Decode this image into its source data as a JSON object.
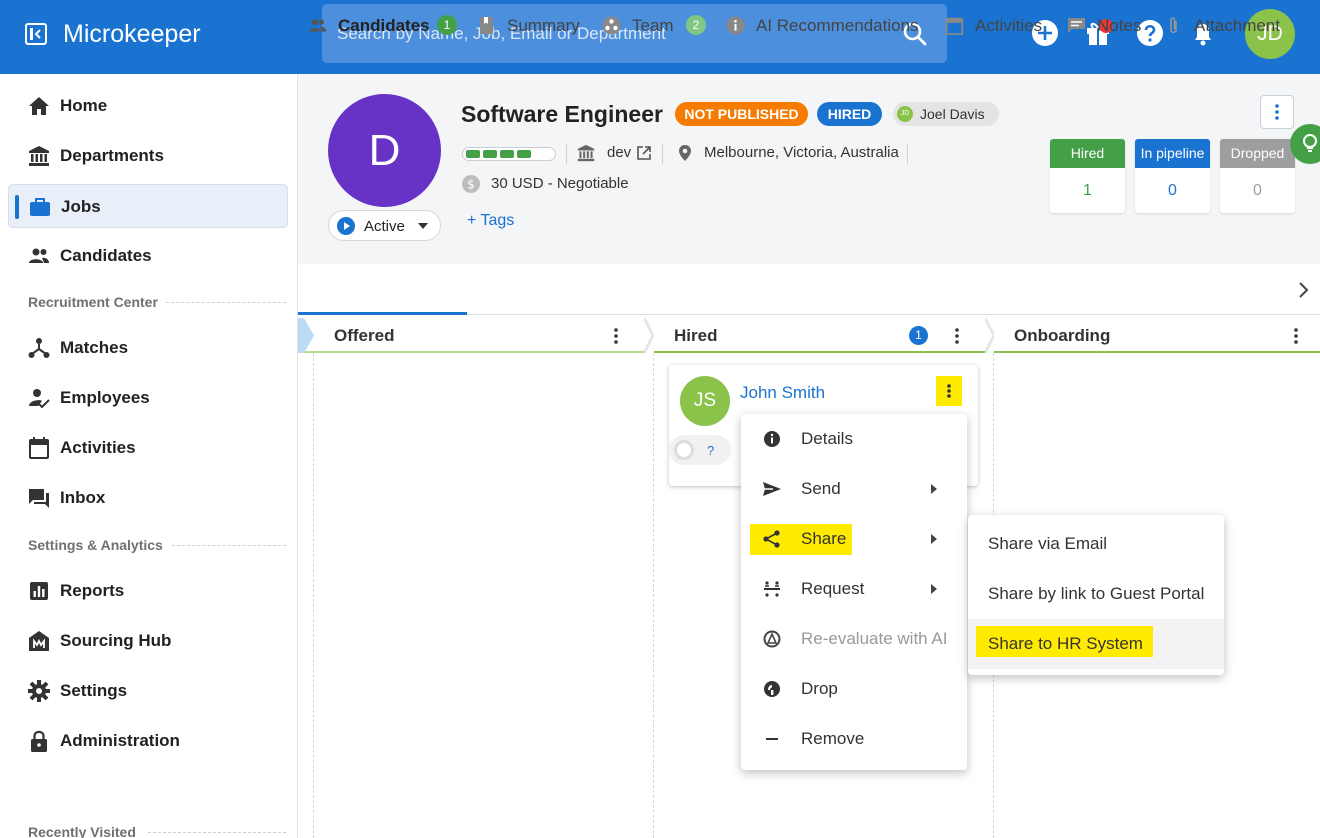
{
  "app": {
    "title": "Microkeeper",
    "search_placeholder": "Search by Name, Job, Email or Department",
    "user_initials": "JD",
    "colors": {
      "primary": "#1a73d1",
      "highlight": "#ffeb00",
      "success": "#43a047"
    }
  },
  "sidebar": {
    "items": [
      {
        "label": "Home",
        "icon": "home-icon"
      },
      {
        "label": "Departments",
        "icon": "bank-icon"
      },
      {
        "label": "Jobs",
        "icon": "briefcase-icon",
        "active": true
      },
      {
        "label": "Candidates",
        "icon": "people-icon"
      },
      {
        "label": "Matches",
        "icon": "network-icon"
      },
      {
        "label": "Employees",
        "icon": "person-check-icon"
      },
      {
        "label": "Activities",
        "icon": "calendar-icon"
      },
      {
        "label": "Inbox",
        "icon": "chat-icon"
      },
      {
        "label": "Reports",
        "icon": "bar-chart-icon"
      },
      {
        "label": "Sourcing Hub",
        "icon": "building-icon"
      },
      {
        "label": "Settings",
        "icon": "gear-icon"
      },
      {
        "label": "Administration",
        "icon": "lock-icon"
      }
    ],
    "sections": {
      "recruitment": "Recruitment Center",
      "settings": "Settings & Analytics",
      "recent": "Recently Visited"
    }
  },
  "job": {
    "avatar_letter": "D",
    "status": "Active",
    "title": "Software Engineer",
    "badges": {
      "published": "NOT PUBLISHED",
      "hired": "HIRED"
    },
    "owner": {
      "initials": "JD",
      "name": "Joel Davis"
    },
    "progress_segments_filled": 4,
    "progress_segments_total": 5,
    "department": "dev",
    "location": "Melbourne, Victoria, Australia",
    "salary": "30 USD - Negotiable",
    "tags_label": "Tags",
    "stats": [
      {
        "label": "Hired",
        "value": "1",
        "color": "#43a047"
      },
      {
        "label": "In pipeline",
        "value": "0",
        "color": "#1a73d1"
      },
      {
        "label": "Dropped",
        "value": "0",
        "color": "#9e9e9e"
      }
    ]
  },
  "tabs": [
    {
      "label": "Candidates",
      "count": "1",
      "icon": "people-icon",
      "active": true
    },
    {
      "label": "Summary",
      "icon": "book-icon"
    },
    {
      "label": "Team",
      "count": "2",
      "icon": "team-icon"
    },
    {
      "label": "AI Recommendations",
      "icon": "info-icon"
    },
    {
      "label": "Activities",
      "icon": "calendar-icon"
    },
    {
      "label": "Notes",
      "icon": "note-icon"
    },
    {
      "label": "Attachment",
      "icon": "paperclip-icon"
    }
  ],
  "columns": [
    {
      "label": "Offered"
    },
    {
      "label": "Hired",
      "count": "1"
    },
    {
      "label": "Onboarding"
    }
  ],
  "card": {
    "initials": "JS",
    "name": "John Smith",
    "rating": "?"
  },
  "context_menu": [
    {
      "label": "Details",
      "icon": "info-icon"
    },
    {
      "label": "Send",
      "icon": "send-icon",
      "submenu": true
    },
    {
      "label": "Share",
      "icon": "share-icon",
      "submenu": true,
      "highlighted": true
    },
    {
      "label": "Request",
      "icon": "request-icon",
      "submenu": true
    },
    {
      "label": "Re-evaluate with AI",
      "icon": "ai-icon",
      "disabled": true
    },
    {
      "label": "Drop",
      "icon": "drop-icon"
    },
    {
      "label": "Remove",
      "icon": "minus-icon"
    }
  ],
  "share_submenu": [
    {
      "label": "Share via Email"
    },
    {
      "label": "Share by link to Guest Portal"
    },
    {
      "label": "Share to HR System",
      "highlighted": true
    }
  ]
}
